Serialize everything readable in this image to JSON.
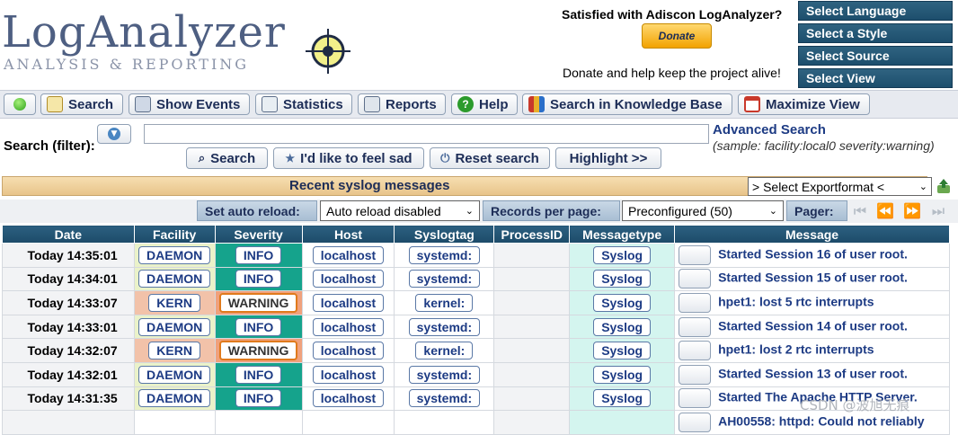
{
  "brand": {
    "title": "LogAnalyzer",
    "subtitle": "ANALYSIS & REPORTING"
  },
  "donate": {
    "title": "Satisfied with Adiscon LogAnalyzer?",
    "button": "Donate",
    "text": "Donate and help keep the project alive!"
  },
  "right_menu": [
    "Select Language",
    "Select a Style",
    "Select Source",
    "Select View"
  ],
  "toolbar": {
    "search": "Search",
    "show_events": "Show Events",
    "statistics": "Statistics",
    "reports": "Reports",
    "help": "Help",
    "kb": "Search in Knowledge Base",
    "maximize": "Maximize View"
  },
  "search": {
    "label": "Search (filter):",
    "value": "",
    "advanced": "Advanced Search",
    "sample": "(sample: facility:local0 severity:warning)",
    "btn_search": "Search",
    "btn_sad": "I'd like to feel sad",
    "btn_reset": "Reset search",
    "btn_highlight": "Highlight >>"
  },
  "recent": {
    "title": "Recent syslog messages",
    "export_select": "> Select Exportformat <"
  },
  "controls": {
    "auto_reload_label": "Set auto reload:",
    "auto_reload_value": "Auto reload disabled",
    "records_label": "Records per page:",
    "records_value": "Preconfigured (50)",
    "pager_label": "Pager:"
  },
  "columns": [
    "Date",
    "Facility",
    "Severity",
    "Host",
    "Syslogtag",
    "ProcessID",
    "Messagetype",
    "Message"
  ],
  "rows": [
    {
      "date": "Today 14:35:01",
      "facility": "DAEMON",
      "severity": "INFO",
      "host": "localhost",
      "tag": "systemd:",
      "pid": "",
      "mtype": "Syslog",
      "message": "Started Session 16 of user root."
    },
    {
      "date": "Today 14:34:01",
      "facility": "DAEMON",
      "severity": "INFO",
      "host": "localhost",
      "tag": "systemd:",
      "pid": "",
      "mtype": "Syslog",
      "message": "Started Session 15 of user root."
    },
    {
      "date": "Today 14:33:07",
      "facility": "KERN",
      "severity": "WARNING",
      "host": "localhost",
      "tag": "kernel:",
      "pid": "",
      "mtype": "Syslog",
      "message": "hpet1: lost 5 rtc interrupts"
    },
    {
      "date": "Today 14:33:01",
      "facility": "DAEMON",
      "severity": "INFO",
      "host": "localhost",
      "tag": "systemd:",
      "pid": "",
      "mtype": "Syslog",
      "message": "Started Session 14 of user root."
    },
    {
      "date": "Today 14:32:07",
      "facility": "KERN",
      "severity": "WARNING",
      "host": "localhost",
      "tag": "kernel:",
      "pid": "",
      "mtype": "Syslog",
      "message": "hpet1: lost 2 rtc interrupts"
    },
    {
      "date": "Today 14:32:01",
      "facility": "DAEMON",
      "severity": "INFO",
      "host": "localhost",
      "tag": "systemd:",
      "pid": "",
      "mtype": "Syslog",
      "message": "Started Session 13 of user root."
    },
    {
      "date": "Today 14:31:35",
      "facility": "DAEMON",
      "severity": "INFO",
      "host": "localhost",
      "tag": "systemd:",
      "pid": "",
      "mtype": "Syslog",
      "message": "Started The Apache HTTP Server."
    },
    {
      "date": "",
      "facility": "",
      "severity": "",
      "host": "",
      "tag": "",
      "pid": "",
      "mtype": "",
      "message": "AH00558: httpd: Could not reliably"
    }
  ],
  "watermark": "CSDN @波旭无痕"
}
